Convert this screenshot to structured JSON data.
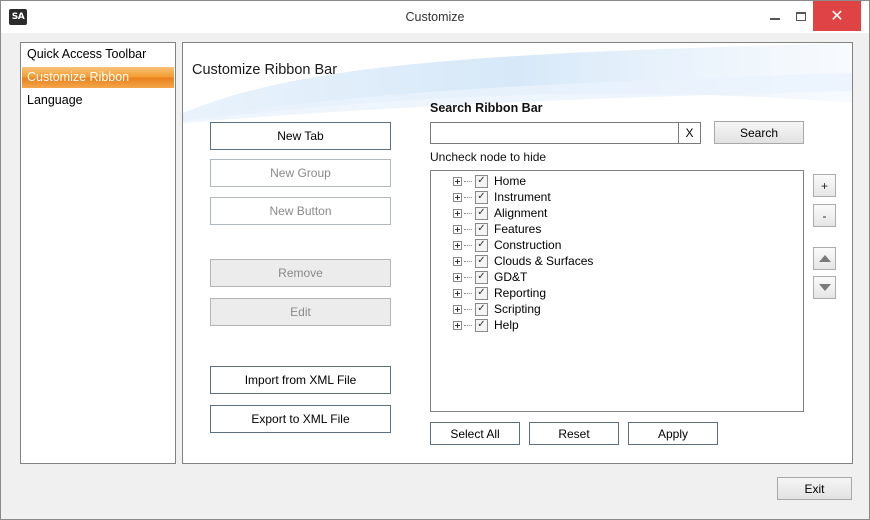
{
  "window": {
    "title": "Customize",
    "app_icon_text": "SA",
    "close_color": "#e04343"
  },
  "nav": {
    "items": [
      {
        "label": "Quick Access Toolbar",
        "selected": false
      },
      {
        "label": "Customize Ribbon",
        "selected": true
      },
      {
        "label": "Language",
        "selected": false
      }
    ]
  },
  "panel": {
    "title": "Customize Ribbon Bar"
  },
  "actions": {
    "new_tab": "New Tab",
    "new_group": "New Group",
    "new_button": "New Button",
    "remove": "Remove",
    "edit": "Edit",
    "import_xml": "Import from XML File",
    "export_xml": "Export to XML File"
  },
  "search": {
    "heading": "Search Ribbon Bar",
    "value": "",
    "placeholder": "",
    "clear_label": "X",
    "button_label": "Search",
    "hint": "Uncheck node to hide"
  },
  "tree": {
    "nodes": [
      {
        "label": "Home",
        "checked": true
      },
      {
        "label": "Instrument",
        "checked": true
      },
      {
        "label": "Alignment",
        "checked": true
      },
      {
        "label": "Features",
        "checked": true
      },
      {
        "label": "Construction",
        "checked": true
      },
      {
        "label": "Clouds & Surfaces",
        "checked": true
      },
      {
        "label": "GD&T",
        "checked": true
      },
      {
        "label": "Reporting",
        "checked": true
      },
      {
        "label": "Scripting",
        "checked": true
      },
      {
        "label": "Help",
        "checked": true
      }
    ]
  },
  "side_buttons": {
    "plus": "+",
    "minus": "-"
  },
  "bottom": {
    "select_all": "Select All",
    "reset": "Reset",
    "apply": "Apply"
  },
  "footer": {
    "exit": "Exit"
  },
  "colors": {
    "accent_orange": "#f39a2c"
  }
}
